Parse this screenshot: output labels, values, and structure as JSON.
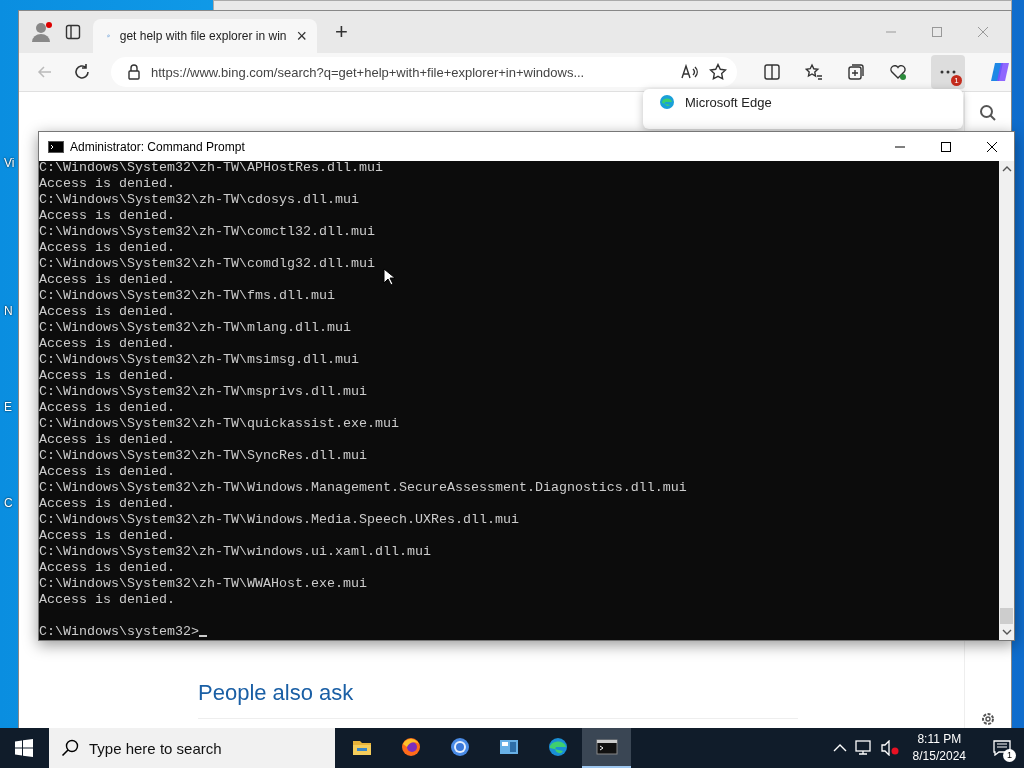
{
  "desktop": {
    "icon_labels": [
      "Vi",
      "N",
      "E",
      "C"
    ]
  },
  "browser": {
    "tab": {
      "title": "get help with file explorer in win",
      "close": "×"
    },
    "new_tab": "+",
    "address": "https://www.bing.com/search?q=get+help+with+file+explorer+in+windows...",
    "more_badge": "1",
    "flyout": {
      "item": "Microsoft Edge"
    },
    "page": {
      "heading": "People also ask"
    }
  },
  "console": {
    "title": "Administrator: Command Prompt",
    "lines": [
      "C:\\Windows\\System32\\zh-TW\\APHostRes.dll.mui",
      "Access is denied.",
      "C:\\Windows\\System32\\zh-TW\\cdosys.dll.mui",
      "Access is denied.",
      "C:\\Windows\\System32\\zh-TW\\comctl32.dll.mui",
      "Access is denied.",
      "C:\\Windows\\System32\\zh-TW\\comdlg32.dll.mui",
      "Access is denied.",
      "C:\\Windows\\System32\\zh-TW\\fms.dll.mui",
      "Access is denied.",
      "C:\\Windows\\System32\\zh-TW\\mlang.dll.mui",
      "Access is denied.",
      "C:\\Windows\\System32\\zh-TW\\msimsg.dll.mui",
      "Access is denied.",
      "C:\\Windows\\System32\\zh-TW\\msprivs.dll.mui",
      "Access is denied.",
      "C:\\Windows\\System32\\zh-TW\\quickassist.exe.mui",
      "Access is denied.",
      "C:\\Windows\\System32\\zh-TW\\SyncRes.dll.mui",
      "Access is denied.",
      "C:\\Windows\\System32\\zh-TW\\Windows.Management.SecureAssessment.Diagnostics.dll.mui",
      "Access is denied.",
      "C:\\Windows\\System32\\zh-TW\\Windows.Media.Speech.UXRes.dll.mui",
      "Access is denied.",
      "C:\\Windows\\System32\\zh-TW\\windows.ui.xaml.dll.mui",
      "Access is denied.",
      "C:\\Windows\\System32\\zh-TW\\WWAHost.exe.mui",
      "Access is denied."
    ],
    "prompt": "C:\\Windows\\system32>"
  },
  "taskbar": {
    "search_placeholder": "Type here to search",
    "apps": [
      {
        "kind": "folder",
        "active": false
      },
      {
        "kind": "firefox",
        "active": false
      },
      {
        "kind": "chrome",
        "active": false
      },
      {
        "kind": "app",
        "active": false
      },
      {
        "kind": "edge",
        "active": false
      },
      {
        "kind": "terminal",
        "active": true
      }
    ],
    "time": "8:11 PM",
    "date": "8/15/2024",
    "notification_count": "1"
  }
}
